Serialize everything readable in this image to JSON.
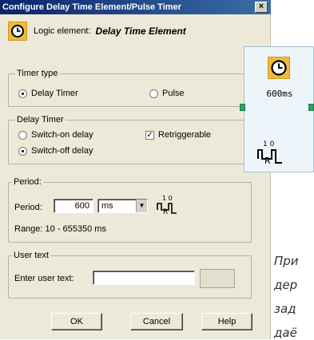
{
  "window": {
    "title": "Configure Delay Time Element/Pulse Timer",
    "close_glyph": "×"
  },
  "logic_element": {
    "label": "Logic element:",
    "value": "Delay Time Element",
    "icon": "clock-icon"
  },
  "timer_type": {
    "title": "Timer type",
    "options": [
      {
        "label": "Delay Timer",
        "selected": true
      },
      {
        "label": "Pulse",
        "selected": false
      }
    ]
  },
  "delay_timer": {
    "title": "Delay Timer",
    "options": [
      {
        "label": "Switch-on delay",
        "selected": false
      },
      {
        "label": "Switch-off delay",
        "selected": true
      }
    ],
    "retriggerable": {
      "label": "Retriggerable",
      "checked": true
    }
  },
  "period": {
    "title": "Period:",
    "field_label": "Period:",
    "value": "600",
    "unit": "ms",
    "range_text": "Range: 10 - 655350 ms",
    "timing_symbol": {
      "top": "1 0",
      "bottom": "R"
    }
  },
  "user_text": {
    "title": "User text",
    "field_label": "Enter user text:",
    "value": ""
  },
  "buttons": {
    "ok": "OK",
    "cancel": "Cancel",
    "help": "Help"
  },
  "block": {
    "value_label": "600ms",
    "symbol_top": "1 0",
    "symbol_bottom": "R"
  },
  "caption_lines": [
    "При",
    "дер",
    "зад",
    "даё"
  ],
  "colors": {
    "title_start": "#0a246a",
    "title_end": "#3a6ea5",
    "dialog_bg": "#ece9d8",
    "clock_badge": "#f0b93a",
    "port_green": "#2aa46a"
  }
}
